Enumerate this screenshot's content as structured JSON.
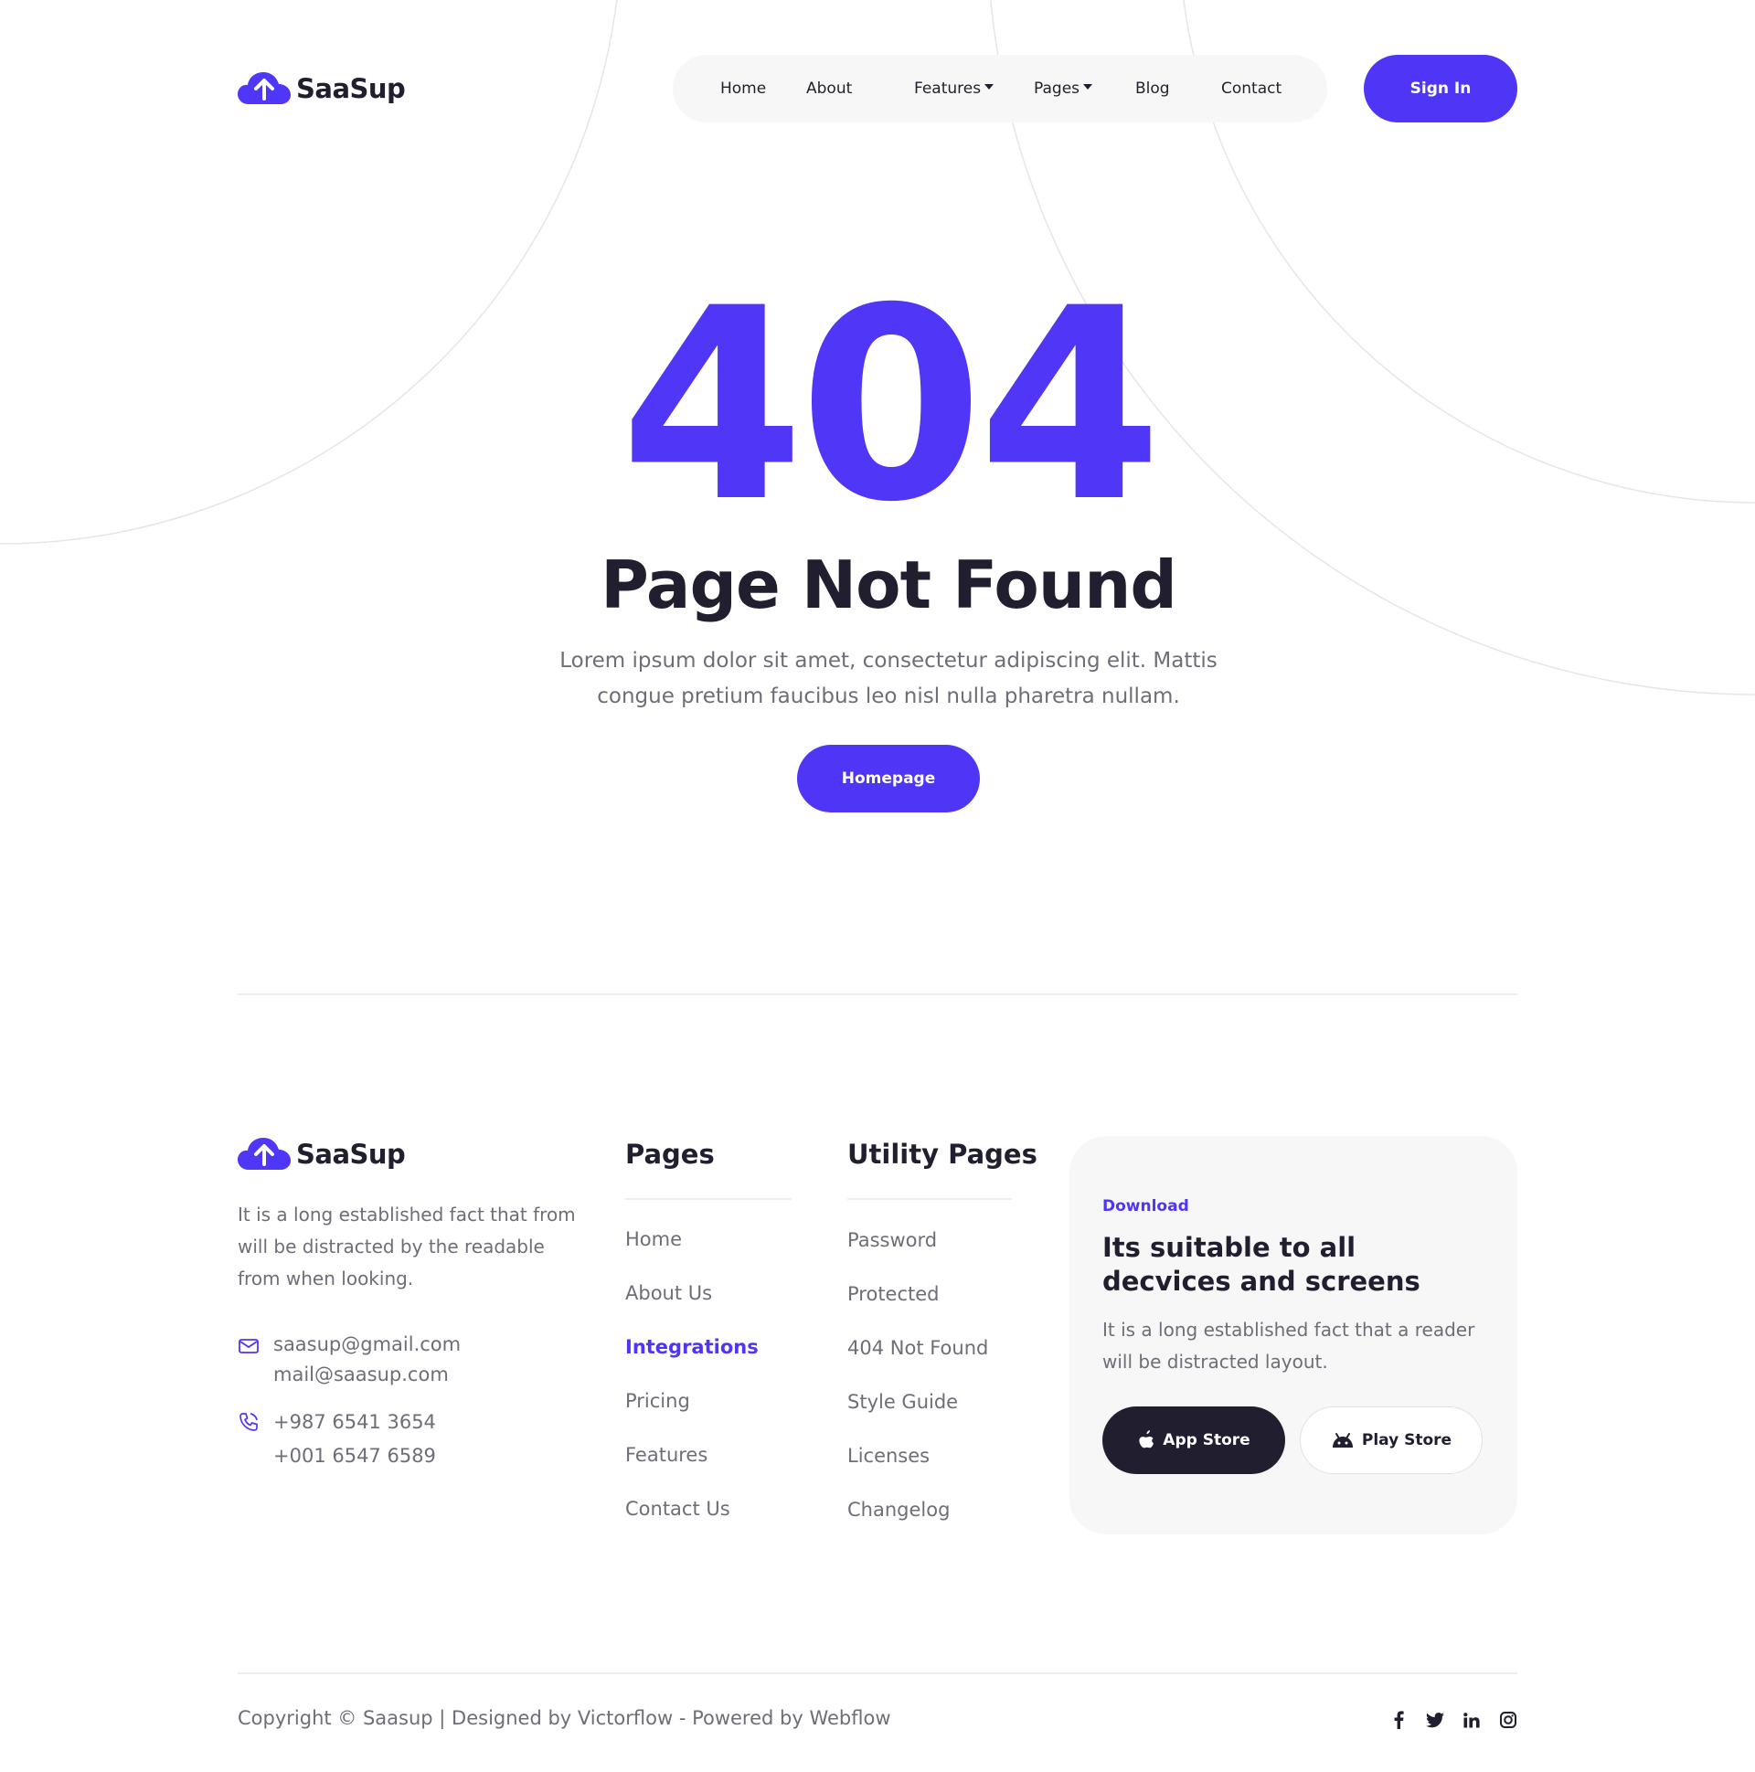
{
  "header": {
    "logo_text": "SaaSup",
    "nav": [
      {
        "label": "Home"
      },
      {
        "label": "About"
      },
      {
        "label": "Features",
        "dropdown": true
      },
      {
        "label": "Pages",
        "dropdown": true
      },
      {
        "label": "Blog"
      },
      {
        "label": "Contact"
      }
    ],
    "signin_label": "Sign In"
  },
  "hero": {
    "code": "404",
    "title": "Page Not Found",
    "description": "Lorem ipsum dolor sit amet, consectetur adipiscing elit. Mattis congue pretium faucibus leo nisl nulla pharetra nullam.",
    "button_label": "Homepage"
  },
  "footer": {
    "logo_text": "SaaSup",
    "about": "It is a long established fact that from will be distracted by the readable from when looking.",
    "emails": [
      "saasup@gmail.com",
      "mail@saasup.com"
    ],
    "phones": [
      "+987 6541 3654",
      "+001 6547 6589"
    ],
    "pages_title": "Pages",
    "pages_links": [
      "Home",
      "About Us",
      "Integrations",
      "Pricing",
      "Features",
      "Contact Us"
    ],
    "pages_active": "Integrations",
    "utility_title": "Utility Pages",
    "utility_links": [
      "Password",
      "Protected",
      "404 Not Found",
      "Style Guide",
      "Licenses",
      "Changelog"
    ],
    "download": {
      "tag": "Download",
      "title": "Its suitable to all decvices and screens",
      "description": "It is a long established fact that a reader will be distracted layout.",
      "app_store_label": "App Store",
      "play_store_label": "Play Store"
    },
    "copyright": "Copyright © Saasup | Designed by Victorflow - Powered by Webflow",
    "socials": [
      "facebook-icon",
      "twitter-icon",
      "linkedin-icon",
      "instagram-icon"
    ]
  },
  "colors": {
    "accent": "#4f35f5",
    "dark": "#211f2f",
    "muted": "#6e6d78",
    "surface": "#f7f7f8"
  }
}
